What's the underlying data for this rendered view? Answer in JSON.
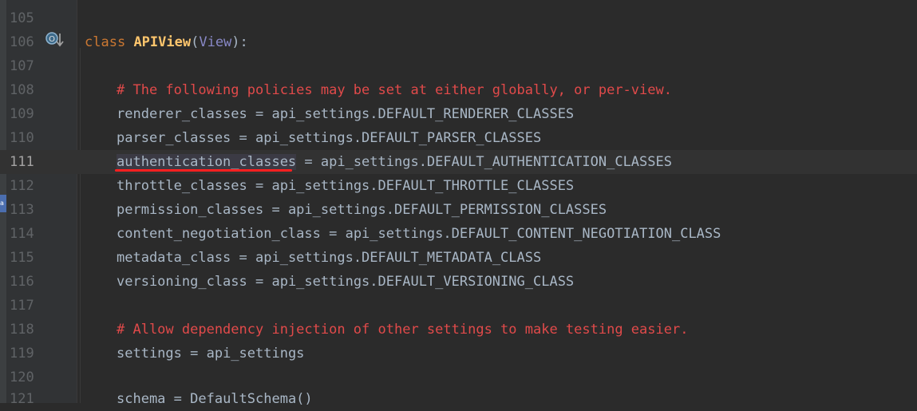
{
  "editor": {
    "left_tab_label": "a",
    "lines": [
      {
        "number": "105",
        "code": ""
      },
      {
        "number": "106",
        "kw": "class",
        "name": "APIView",
        "base": "View",
        "tail": "):"
      },
      {
        "number": "107",
        "code": ""
      },
      {
        "number": "108",
        "comment": "# The following policies may be set at either globally, or per-view."
      },
      {
        "number": "109",
        "attr": "renderer_classes",
        "rest": " = api_settings.DEFAULT_RENDERER_CLASSES"
      },
      {
        "number": "110",
        "attr": "parser_classes",
        "rest": " = api_settings.DEFAULT_PARSER_CLASSES"
      },
      {
        "number": "111",
        "attr": "authentication_classes",
        "rest": " = api_settings.DEFAULT_AUTHENTICATION_CLASSES"
      },
      {
        "number": "112",
        "attr": "throttle_classes",
        "rest": " = api_settings.DEFAULT_THROTTLE_CLASSES"
      },
      {
        "number": "113",
        "attr": "permission_classes",
        "rest": " = api_settings.DEFAULT_PERMISSION_CLASSES"
      },
      {
        "number": "114",
        "attr": "content_negotiation_class",
        "rest": " = api_settings.DEFAULT_CONTENT_NEGOTIATION_CLASS"
      },
      {
        "number": "115",
        "attr": "metadata_class",
        "rest": " = api_settings.DEFAULT_METADATA_CLASS"
      },
      {
        "number": "116",
        "attr": "versioning_class",
        "rest": " = api_settings.DEFAULT_VERSIONING_CLASS"
      },
      {
        "number": "117",
        "code": ""
      },
      {
        "number": "118",
        "comment": "# Allow dependency injection of other settings to make testing easier."
      },
      {
        "number": "119",
        "attr": "settings",
        "rest": " = api_settings"
      },
      {
        "number": "120",
        "code": ""
      },
      {
        "number": "121",
        "attr": "schema",
        "rest": " = DefaultSchema()"
      }
    ],
    "colors": {
      "background": "#2b2b2b",
      "keyword": "#cc7832",
      "class_name": "#ffc66d",
      "comment": "#e14a4a",
      "text": "#a9b7c6",
      "annotation_underline": "#ff2020"
    },
    "gutter_icon": "override-method-icon"
  }
}
